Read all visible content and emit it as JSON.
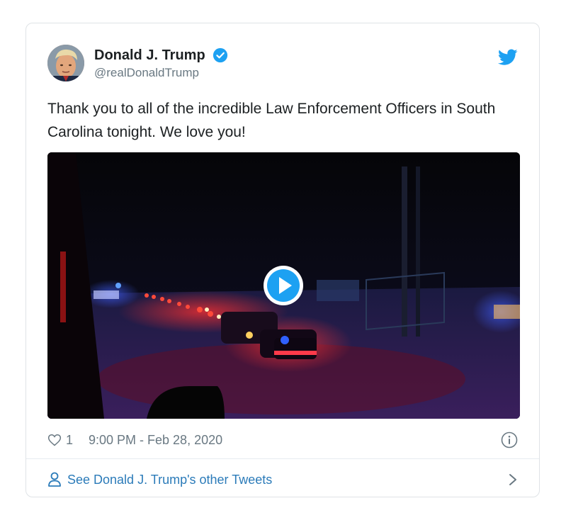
{
  "tweet": {
    "display_name": "Donald J. Trump",
    "handle": "@realDonaldTrump",
    "text": "Thank you to all of the incredible Law Enforcement Officers in South Carolina tonight. We love you!",
    "like_count": "1",
    "timestamp": "9:00 PM - Feb 28, 2020",
    "verified": true
  },
  "footer": {
    "see_more_label": "See Donald J. Trump's other Tweets"
  },
  "icons": {
    "brand": "twitter-bird-icon",
    "verified": "verified-badge-icon",
    "like": "heart-icon",
    "info": "info-icon",
    "person": "person-icon",
    "chevron": "chevron-right-icon",
    "play": "play-icon"
  },
  "colors": {
    "brand_blue": "#1da1f2",
    "link_blue": "#2b7bb9",
    "muted_text": "#697882",
    "text": "#1c2022",
    "border": "#dfe3e6"
  }
}
